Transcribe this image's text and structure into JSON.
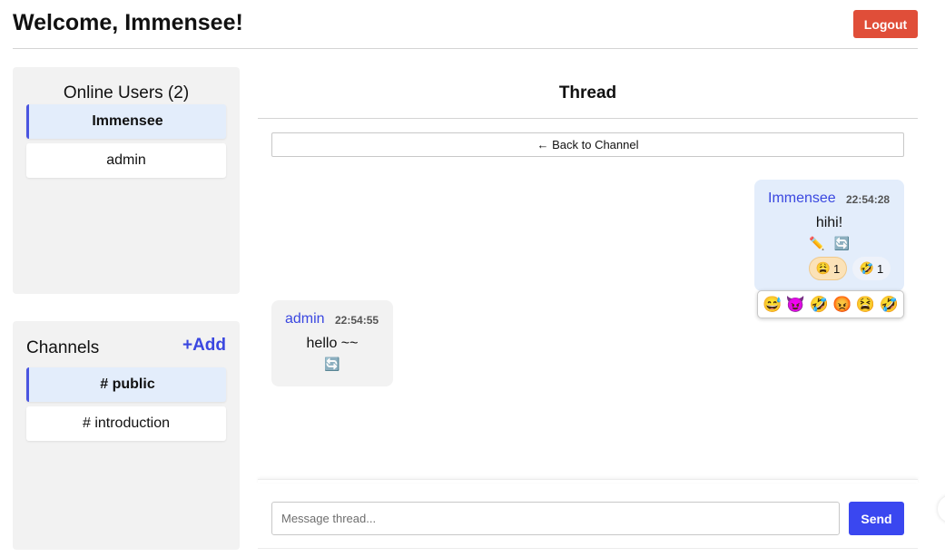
{
  "header": {
    "title": "Welcome, Immensee!",
    "logout_label": "Logout"
  },
  "users": {
    "title": "Online Users (2)",
    "items": [
      {
        "label": "Immensee",
        "active": true
      },
      {
        "label": "admin",
        "active": false
      }
    ]
  },
  "channels": {
    "title": "Channels",
    "add_label": "+Add",
    "items": [
      {
        "label": "# public",
        "active": true
      },
      {
        "label": "# introduction",
        "active": false
      }
    ]
  },
  "thread": {
    "title": "Thread",
    "back_label": "← Back to Channel",
    "messages": [
      {
        "author": "Immensee",
        "time": "22:54:28",
        "text": "hihi!",
        "actions": [
          "✏️",
          "🔄"
        ],
        "reactions": [
          {
            "emoji": "😩",
            "count": "1",
            "selected": true
          },
          {
            "emoji": "🤣",
            "count": "1",
            "selected": false
          }
        ]
      },
      {
        "author": "admin",
        "time": "22:54:55",
        "text": "hello ~~",
        "actions": [
          "🔄"
        ]
      }
    ],
    "emoji_picker": [
      "😅",
      "😈",
      "🤣",
      "😡",
      "😫",
      "🤣"
    ],
    "input_placeholder": "Message thread...",
    "send_label": "Send"
  },
  "colors": {
    "accent": "#3a47f0",
    "logout": "#e04e39",
    "active_item": "#e3edfb",
    "panel": "#f2f2f2"
  }
}
